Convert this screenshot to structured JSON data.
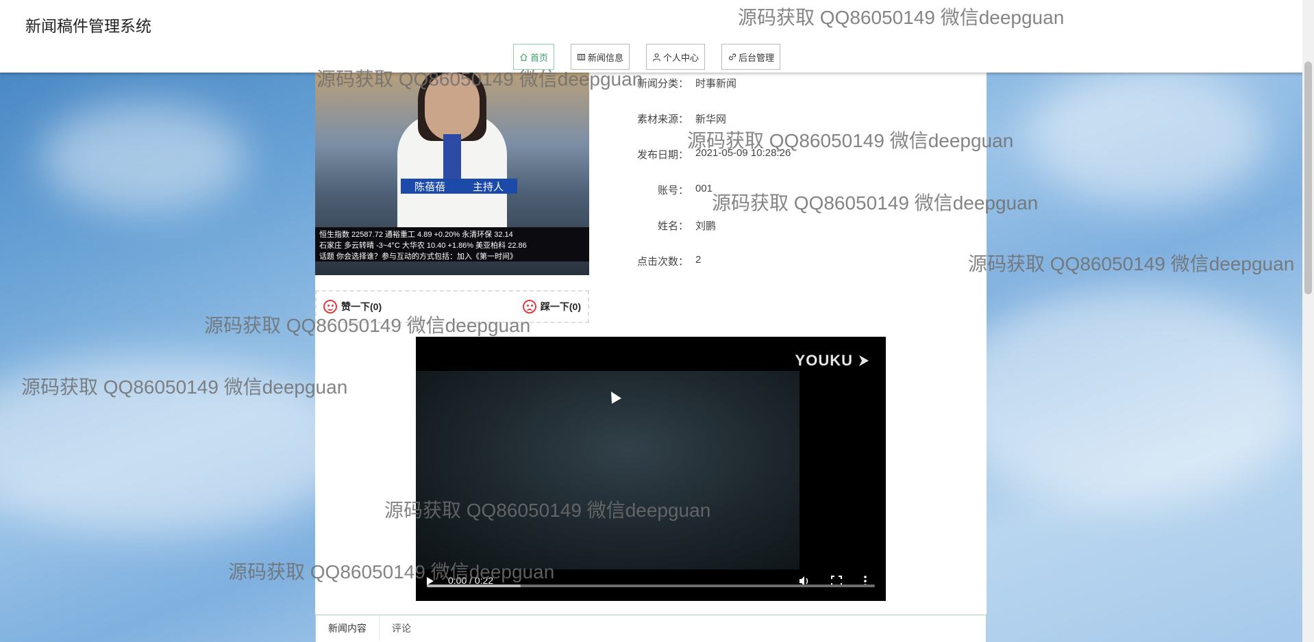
{
  "header": {
    "title": "新闻稿件管理系统",
    "nav": [
      {
        "label": "首页",
        "icon": "home-icon"
      },
      {
        "label": "新闻信息",
        "icon": "news-icon"
      },
      {
        "label": "个人中心",
        "icon": "user-icon"
      },
      {
        "label": "后台管理",
        "icon": "link-icon"
      }
    ]
  },
  "image": {
    "caption_name": "陈蓓蓓",
    "caption_role": "主持人",
    "ticker_line1": "恒生指数 22587.72   通裕重工 4.89 +0.20% 永清环保 32.14",
    "ticker_line2": "石家庄 多云转晴 -3~4°C   大华农 10.40 +1.86% 美亚柏科 22.86",
    "ticker_line3": "话题 你会选择谁？参与互动的方式包括：加入《第一时间》"
  },
  "votes": {
    "like": "赞一下(0)",
    "dislike": "踩一下(0)"
  },
  "details": [
    {
      "label": "新闻分类：",
      "value": "时事新闻"
    },
    {
      "label": "素材来源：",
      "value": "新华网"
    },
    {
      "label": "发布日期：",
      "value": "2021-05-09 10:28:26"
    },
    {
      "label": "账号：",
      "value": "001"
    },
    {
      "label": "姓名：",
      "value": "刘鹏"
    },
    {
      "label": "点击次数：",
      "value": "2"
    }
  ],
  "video": {
    "brand": "YOUKU",
    "time": "0:00 / 0:22",
    "progress_fraction": 0.21
  },
  "tabs": [
    "新闻内容",
    "评论"
  ],
  "watermark": "源码获取 QQ86050149 微信deepguan"
}
